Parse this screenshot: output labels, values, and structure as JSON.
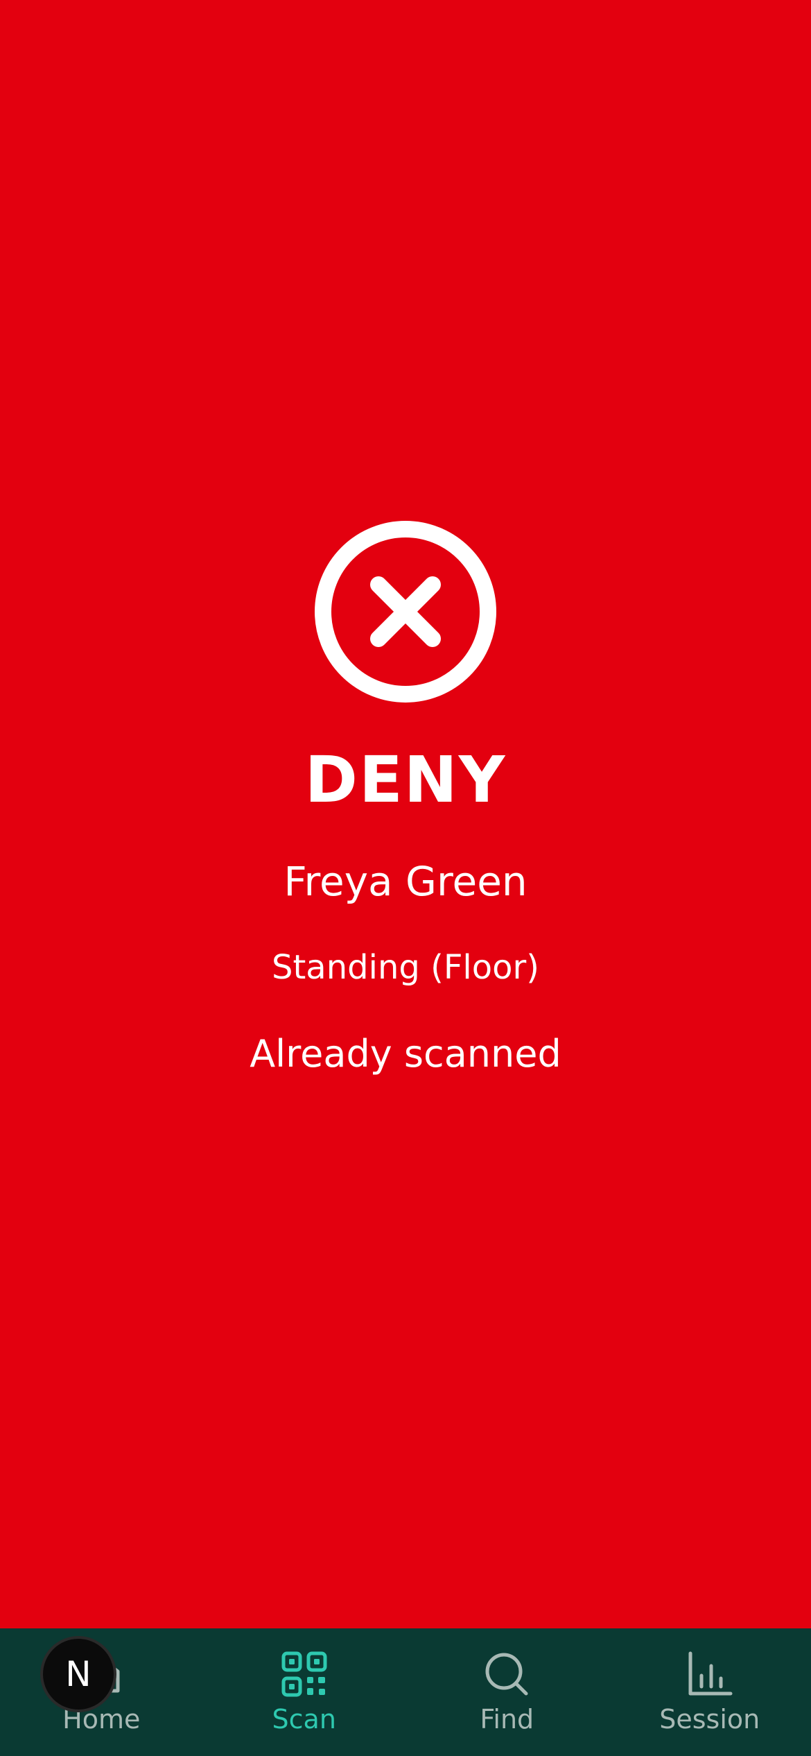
{
  "result": {
    "verdict": "DENY",
    "holder_name": "Freya Green",
    "ticket_type": "Standing (Floor)",
    "reason": "Already scanned",
    "status_icon": "x-circle-icon",
    "background_color": "#e3000f"
  },
  "nav": {
    "active": "Scan",
    "background_color": "#0a3a33",
    "active_color": "#2ec9b0",
    "items": [
      {
        "label": "Home",
        "icon": "home-icon"
      },
      {
        "label": "Scan",
        "icon": "qr-code-icon"
      },
      {
        "label": "Find",
        "icon": "search-icon"
      },
      {
        "label": "Session",
        "icon": "bar-chart-icon"
      }
    ]
  },
  "dev_badge": {
    "label": "N",
    "icon": "nextjs-badge-icon"
  }
}
